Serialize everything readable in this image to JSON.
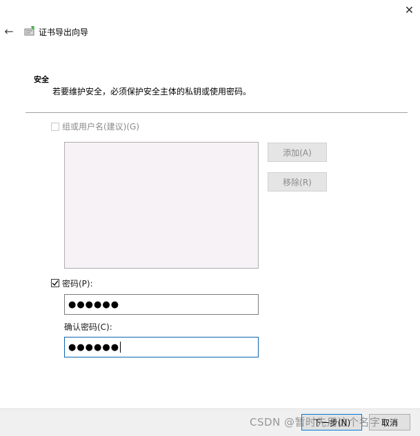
{
  "window": {
    "close_glyph": "✕",
    "title": "证书导出向导"
  },
  "icons": {
    "back": "back-arrow-icon",
    "wizard": "certificate-wizard-icon",
    "close": "close-icon",
    "check": "checkmark-icon"
  },
  "nav": {
    "back_glyph": "←"
  },
  "section": {
    "title": "安全",
    "description": "若要维护安全，必须保护安全主体的私钥或使用密码。"
  },
  "group_option": {
    "label": "组或用户名(建议)(G)",
    "checked": false,
    "enabled": false
  },
  "group_list": {
    "items": []
  },
  "buttons": {
    "add": "添加(A)",
    "remove": "移除(R)"
  },
  "password_option": {
    "label": "密码(P):",
    "checked": true
  },
  "password": {
    "value": "●●●●●●"
  },
  "confirm": {
    "label": "确认密码(C):",
    "value": "●●●●●●"
  },
  "footer": {
    "next": "下一步(N)",
    "cancel": "取消"
  },
  "watermark": "CSDN @暂时先用这个名字",
  "colors": {
    "accent": "#0078d7",
    "list_bg": "#f6f2f5",
    "footer_bg": "#f0f0f0"
  }
}
